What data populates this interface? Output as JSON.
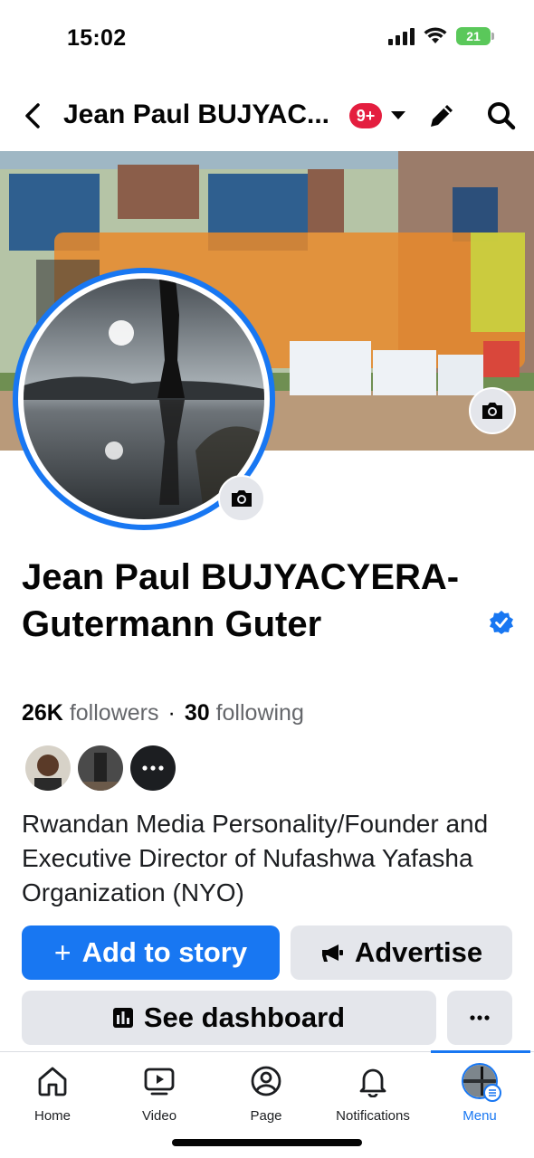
{
  "status_bar": {
    "time": "15:02",
    "battery": "21"
  },
  "header": {
    "title": "Jean Paul BUJYAC...",
    "badge": "9+"
  },
  "profile": {
    "name": "Jean Paul BUJYACYERA-Gutermann Guter",
    "followers_count": "26K",
    "followers_label": "followers",
    "separator": "·",
    "following_count": "30",
    "following_label": "following",
    "bio": "Rwandan Media Personality/Founder and Executive Director of Nufashwa Yafasha Organization (NYO)"
  },
  "buttons": {
    "add_story": "Add to story",
    "add_story_icon": "+",
    "advertise": "Advertise",
    "dashboard": "See dashboard",
    "more": "···"
  },
  "tabs": [
    {
      "label": "Home",
      "icon": "home-icon"
    },
    {
      "label": "Video",
      "icon": "video-icon"
    },
    {
      "label": "Page",
      "icon": "page-icon"
    },
    {
      "label": "Notifications",
      "icon": "bell-icon"
    },
    {
      "label": "Menu",
      "icon": "menu-avatar",
      "active": true
    }
  ],
  "colors": {
    "accent": "#1877f2",
    "badge": "#e41e3f",
    "button_secondary": "#e4e6eb"
  }
}
